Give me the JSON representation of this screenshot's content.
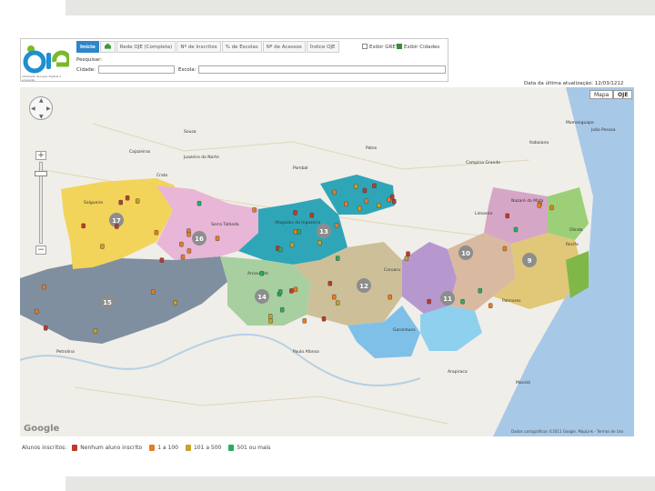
{
  "logo": {
    "text": "OJE",
    "tagline": "olimpíada de jogos digitais e educação"
  },
  "tabs": [
    {
      "label": "Início",
      "active": true
    },
    {
      "label": "Rede OJE (Completa)",
      "active": false
    },
    {
      "label": "Nº de Inscritos",
      "active": false
    },
    {
      "label": "% de Escolas",
      "active": false
    },
    {
      "label": "Nº de Acessos",
      "active": false
    },
    {
      "label": "Índice OJE",
      "active": false
    }
  ],
  "options": {
    "gre_label": "Exibir GRE's",
    "gre_checked": false,
    "cidades_label": "Exibir Cidades",
    "cidades_checked": true
  },
  "search": {
    "title": "Pesquisar:",
    "city_label": "Cidade:",
    "city_value": "",
    "school_label": "Escola:",
    "school_value": ""
  },
  "last_update": "Data da última atualização: 12/03/1212",
  "map": {
    "type_buttons": [
      "Mapa",
      "OJE"
    ],
    "watermark": "Google",
    "attribution": "Dados cartográficos ©2011 Google, MapLink - Termos de Uso",
    "gre_numbers": [
      "17",
      "16",
      "15",
      "14",
      "13",
      "12",
      "11",
      "10",
      "9"
    ],
    "city_labels": [
      "Salgueiro",
      "Serra Talhada",
      "Afogados da Ingazeira",
      "Arcoverde",
      "Caruaru",
      "Garanhuns",
      "Petrolina",
      "Palmares",
      "Limoeiro",
      "Nazaré da Mata",
      "Recife",
      "Olinda",
      "Campina Grande",
      "Patos",
      "Sousa",
      "Cajazeiras",
      "Crato",
      "Juazeiro do Norte",
      "Paulo Afonso",
      "Arapiraca",
      "Maceió",
      "João Pessoa",
      "Pombal",
      "Itabaiana",
      "Mamanguape"
    ]
  },
  "legend": {
    "title": "Alunos inscritos:",
    "items": [
      {
        "label": "Nenhum aluno inscrito",
        "color": "#c0392b"
      },
      {
        "label": "1 a 100",
        "color": "#e67e22"
      },
      {
        "label": "101 a 500",
        "color": "#c9a227"
      },
      {
        "label": "501 ou mais",
        "color": "#27ae60"
      }
    ]
  },
  "colors": {
    "accent": "#2f86c8",
    "region_gray": "#7f8fa0",
    "region_yellow": "#f2d45a",
    "region_pink": "#e8b6d6",
    "region_teal": "#2fa6b8",
    "region_tan": "#cdbf98",
    "region_blue": "#7fc0e8",
    "region_green": "#a8cfa0",
    "region_purple": "#b698cf"
  }
}
